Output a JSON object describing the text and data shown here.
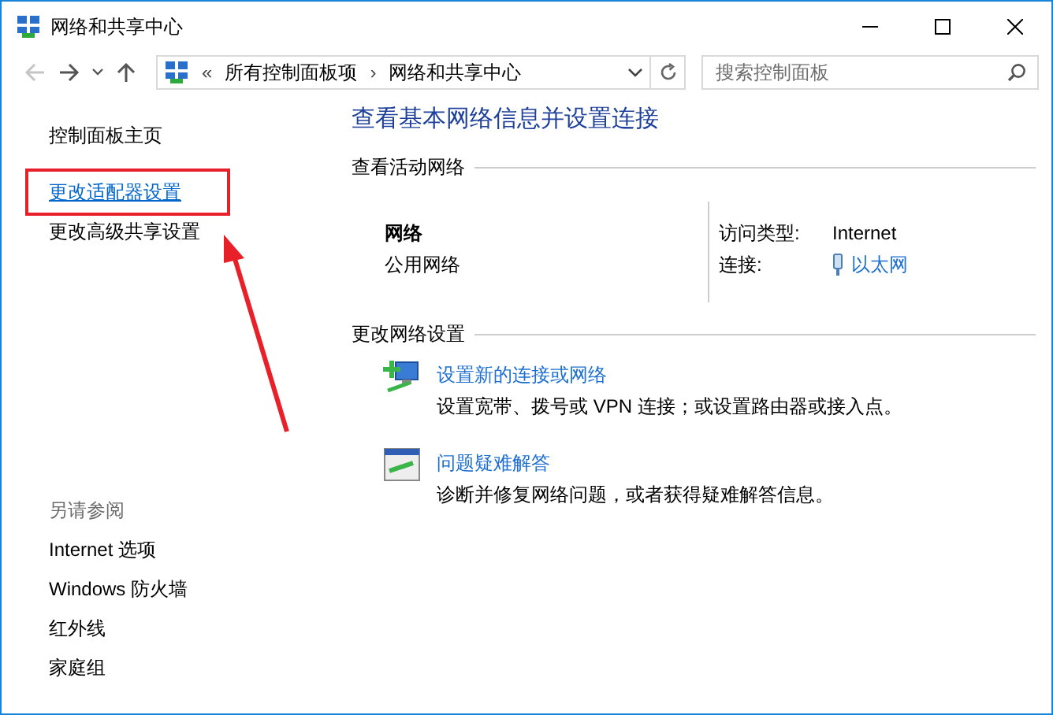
{
  "window": {
    "title": "网络和共享中心"
  },
  "address_bar": {
    "path": [
      {
        "text": "«",
        "kind": "overflow"
      },
      {
        "text": "所有控制面板项",
        "kind": "crumb"
      },
      {
        "text": "›",
        "kind": "separator"
      },
      {
        "text": "网络和共享中心",
        "kind": "crumb"
      }
    ],
    "search_placeholder": "搜索控制面板"
  },
  "sidebar": {
    "items": [
      {
        "label": "控制面板主页",
        "hovered": false,
        "highlighted": false
      },
      {
        "label": "更改适配器设置",
        "hovered": true,
        "highlighted": true
      },
      {
        "label": "更改高级共享设置",
        "hovered": false,
        "highlighted": false
      }
    ],
    "see_also": {
      "heading": "另请参阅",
      "items": [
        {
          "label": "Internet 选项"
        },
        {
          "label": "Windows 防火墙"
        },
        {
          "label": "红外线"
        },
        {
          "label": "家庭组"
        }
      ]
    }
  },
  "main": {
    "heading": "查看基本网络信息并设置连接",
    "active_networks": {
      "heading": "查看活动网络",
      "network_name": "网络",
      "network_type": "公用网络",
      "access_type_label": "访问类型:",
      "access_type": "Internet",
      "connections_label": "连接:",
      "connection": "以太网"
    },
    "change_settings": {
      "heading": "更改网络设置",
      "tasks": [
        {
          "kind": "new-connection",
          "title": "设置新的连接或网络",
          "description": "设置宽带、拨号或 VPN 连接；或设置路由器或接入点。"
        },
        {
          "kind": "troubleshoot",
          "title": "问题疑难解答",
          "description": "诊断并修复网络问题，或者获得疑难解答信息。"
        }
      ]
    }
  }
}
